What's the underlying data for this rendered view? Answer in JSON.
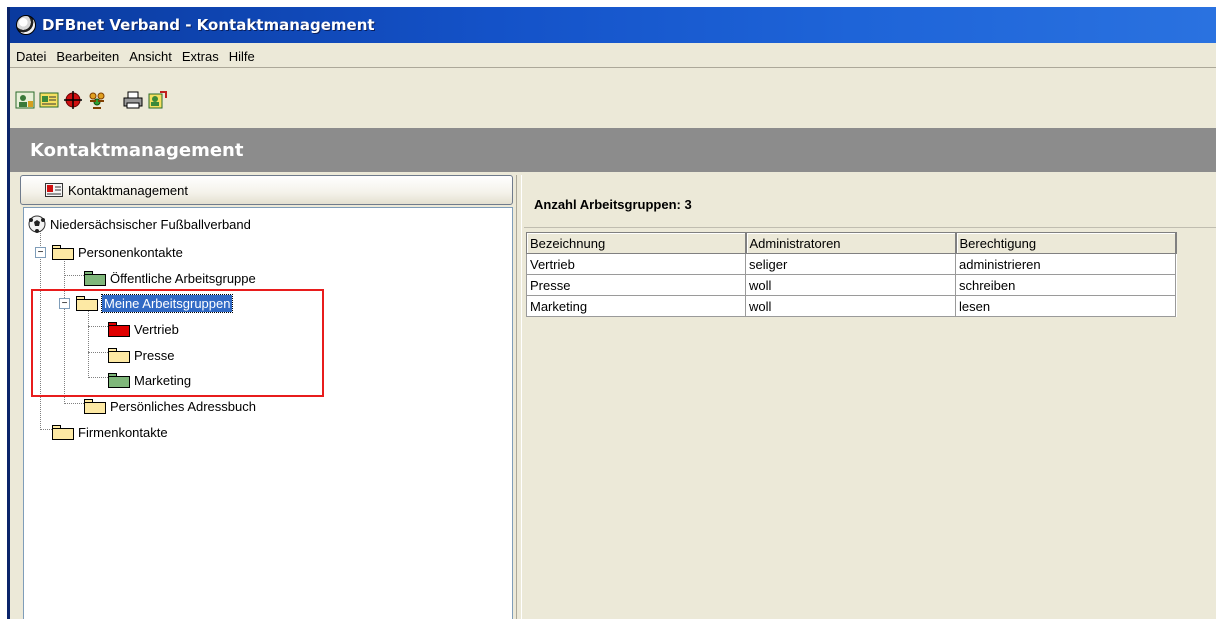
{
  "window": {
    "title": "DFBnet Verband - Kontaktmanagement"
  },
  "menu": [
    "Datei",
    "Bearbeiten",
    "Ansicht",
    "Extras",
    "Hilfe"
  ],
  "toolbar": {
    "icons": [
      "user-contact-icon",
      "address-card-icon",
      "target-icon",
      "group-icon",
      "print-icon",
      "export-icon"
    ]
  },
  "header": {
    "title": "Kontaktmanagement"
  },
  "nav_button": {
    "label": "Kontaktmanagement"
  },
  "tree": {
    "root": "Niedersächsischer Fußballverband",
    "personenkontakte": "Personenkontakte",
    "oeffentliche": "Öffentliche Arbeitsgruppe",
    "meine": "Meine Arbeitsgruppen",
    "vertrieb": "Vertrieb",
    "presse": "Presse",
    "marketing": "Marketing",
    "adressbuch": "Persönliches Adressbuch",
    "firmenkontakte": "Firmenkontakte"
  },
  "colors": {
    "folder_yellow": "#fde9a4",
    "folder_green": "#7fb77a",
    "folder_red": "#e00000",
    "header_gray": "#8c8c8c",
    "highlight_red": "#e81c1c",
    "selection_blue": "#316ac5"
  },
  "detail": {
    "count_label": "Anzahl Arbeitsgruppen: 3",
    "columns": [
      "Bezeichnung",
      "Administratoren",
      "Berechtigung"
    ],
    "rows": [
      [
        "Vertrieb",
        "seliger",
        "administrieren"
      ],
      [
        "Presse",
        "woll",
        "schreiben"
      ],
      [
        "Marketing",
        "woll",
        "lesen"
      ]
    ]
  }
}
